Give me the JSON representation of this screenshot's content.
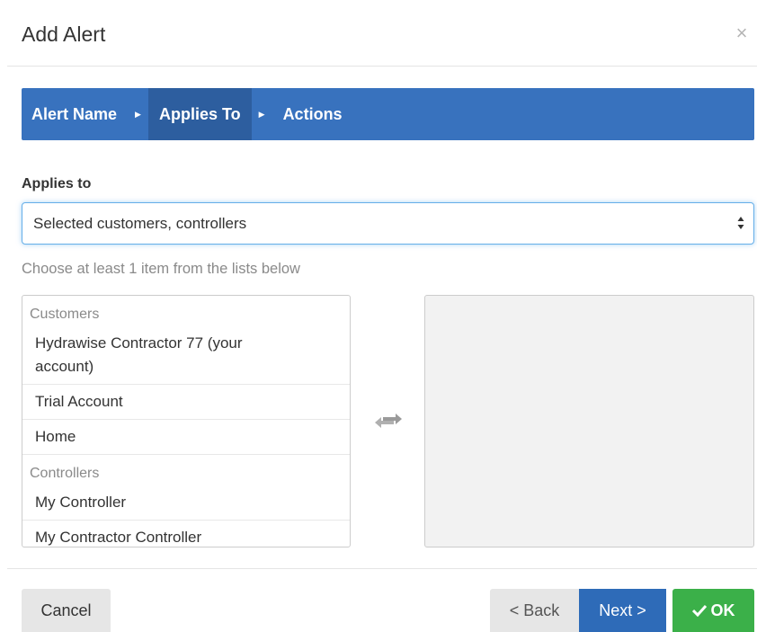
{
  "dialog": {
    "title": "Add Alert",
    "close_icon": "close-icon"
  },
  "wizard": {
    "steps": [
      {
        "label": "Alert Name",
        "active": false
      },
      {
        "label": "Applies To",
        "active": true
      },
      {
        "label": "Actions",
        "active": false
      }
    ],
    "separator": "▶",
    "active_color": "#2d5e9f",
    "bar_color": "#3872be"
  },
  "applies_to": {
    "label": "Applies to",
    "selected_value": "Selected customers, controllers"
  },
  "hint": "Choose at least 1 item from the lists below",
  "available_list": {
    "groups": [
      {
        "header": "Customers",
        "items": [
          "Hydrawise Contractor 77 (your account)",
          "Trial Account",
          "Home"
        ]
      },
      {
        "header": "Controllers",
        "items": [
          "My Controller",
          "My Contractor Controller"
        ]
      }
    ]
  },
  "transfer_icon": "swap-arrows-icon",
  "footer": {
    "cancel_label": "Cancel",
    "back_label": "< Back",
    "next_label": "Next >",
    "ok_label": "OK",
    "ok_icon": "checkmark-icon",
    "ok_color": "#3bb049",
    "next_color": "#2e6bb8"
  }
}
